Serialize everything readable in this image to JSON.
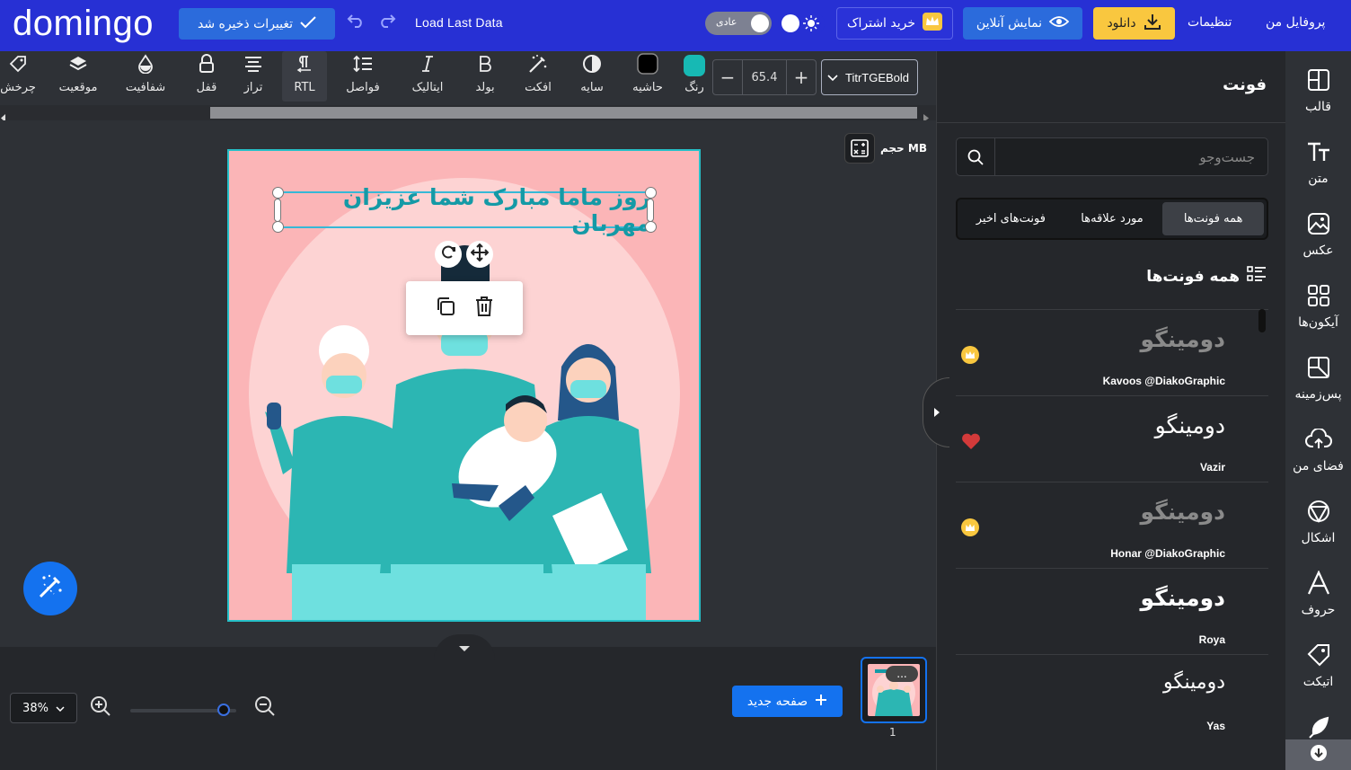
{
  "header": {
    "logo": "domingo",
    "saved_label": "تغییرات ذخیره شد",
    "load_last": "Load Last Data",
    "mode_label": "عادی",
    "subscription_label": "خرید اشتراک",
    "preview_label": "نمایش آنلاین",
    "download_label": "دانلود",
    "settings_label": "تنظیمات",
    "profile_label": "پروفایل من",
    "colors": {
      "bar": "#2730d4",
      "download": "#f9c73f",
      "accent": "#2b6bdc"
    }
  },
  "toolbar": {
    "rotate": "چرخش",
    "position": "موقعیت",
    "opacity": "شفافیت",
    "lock": "قفل",
    "align": "تراز",
    "rtl": "RTL",
    "spacing": "فواصل",
    "italic": "ایتالیک",
    "bold": "بولد",
    "effect": "افکت",
    "shadow": "سایه",
    "border": "حاشیه",
    "color": "رنگ",
    "color_value": "#17b9b4",
    "font_size": "65.4",
    "font_family": "TitrTGEBold"
  },
  "canvas": {
    "size_label": "حجم MB",
    "title_text": "روز ماما مبارک شما عزیزان مهربان",
    "background": "#fbb5b7",
    "text_color": "#149aa6"
  },
  "bottom": {
    "zoom": "38%",
    "zoom_level": 0.88,
    "new_page": "صفحه جدید",
    "page_number": "1",
    "page_menu": "..."
  },
  "panel": {
    "title": "فونت",
    "search_placeholder": "جست‌وجو",
    "tabs": [
      {
        "label": "همه فونت‌ها",
        "active": true
      },
      {
        "label": "مورد علاقه‌ها",
        "active": false
      },
      {
        "label": "فونت‌های اخیر",
        "active": false
      }
    ],
    "section_title": "همه فونت‌ها",
    "fonts": [
      {
        "sample": "دومینگو",
        "name": "Kavoos @DiakoGraphic",
        "marker": "crown"
      },
      {
        "sample": "دومینگو",
        "name": "Vazir",
        "marker": "heart"
      },
      {
        "sample": "دومینگو",
        "name": "Honar @DiakoGraphic",
        "marker": "crown"
      },
      {
        "sample": "دومینگو",
        "name": "Roya",
        "marker": "none"
      },
      {
        "sample": "دومینگو",
        "name": "Yas",
        "marker": "none"
      }
    ]
  },
  "nav": {
    "items": [
      "قالب",
      "متن",
      "عکس",
      "آیکون‌ها",
      "پس‌زمینه",
      "فضای من",
      "اشکال",
      "حروف",
      "اتیکت"
    ]
  }
}
